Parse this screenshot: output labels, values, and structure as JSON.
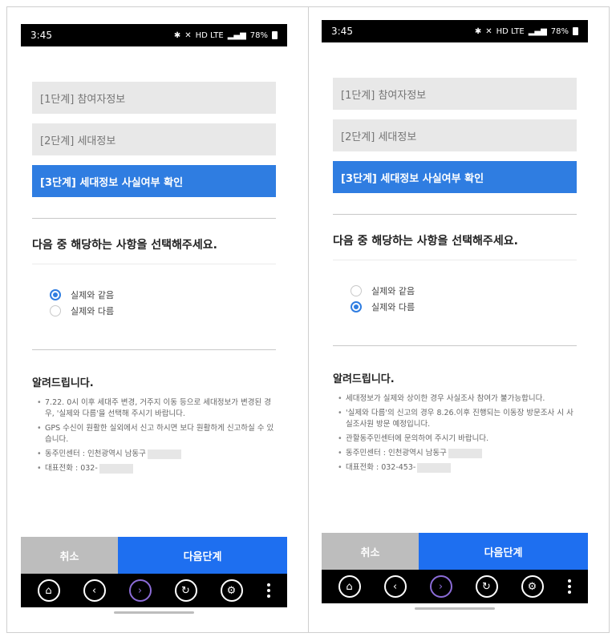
{
  "left": {
    "status": {
      "time": "3:45",
      "signal_text": "HD LTE",
      "battery": "78%"
    },
    "steps": [
      {
        "label": "[1단계] 참여자정보"
      },
      {
        "label": "[2단계] 세대정보"
      },
      {
        "label": "[3단계] 세대정보 사실여부 확인"
      }
    ],
    "question": "다음 중 해당하는 사항을 선택해주세요.",
    "options": [
      {
        "label": "실제와 같음",
        "selected": true
      },
      {
        "label": "실제와 다름",
        "selected": false
      }
    ],
    "notice_title": "알려드립니다.",
    "notices": [
      "7.22. 0시 이후 세대주 변경, 거주지 이동 등으로 세대정보가 변경된 경우, '실제와 다름'을 선택해 주시기 바랍니다.",
      "GPS 수신이 원활한 실외에서 신고 하시면 보다 원활하게 신고하실 수 있습니다.",
      "동주민센터 : 인천광역시 남동구",
      "대표전화 : 032-"
    ],
    "buttons": {
      "cancel": "취소",
      "next": "다음단계"
    }
  },
  "right": {
    "status": {
      "time": "3:45",
      "signal_text": "HD LTE",
      "battery": "78%"
    },
    "steps": [
      {
        "label": "[1단계] 참여자정보"
      },
      {
        "label": "[2단계] 세대정보"
      },
      {
        "label": "[3단계] 세대정보 사실여부 확인"
      }
    ],
    "question": "다음 중 해당하는 사항을 선택해주세요.",
    "options": [
      {
        "label": "실제와 같음",
        "selected": false
      },
      {
        "label": "실제와 다름",
        "selected": true
      }
    ],
    "notice_title": "알려드립니다.",
    "notices": [
      "세대정보가 실제와 상이한 경우 사실조사 참여가 불가능합니다.",
      "'실제와 다름'의 신고의 경우 8.26.이후 진행되는 이동장 방문조사 시 사실조사원 방문 예정입니다.",
      "관할동주민센터에 문의하여 주시기 바랍니다.",
      "동주민센터 : 인천광역시 남동구",
      "대표전화 : 032-453-"
    ],
    "buttons": {
      "cancel": "취소",
      "next": "다음단계"
    }
  },
  "navbar_icons": [
    "home-icon",
    "back-icon",
    "forward-icon",
    "refresh-icon",
    "settings-icon",
    "more-icon"
  ],
  "colors": {
    "accent": "#2f7de1",
    "next_button": "#1e6ff0",
    "cancel_button": "#bdbdbd",
    "forward_icon": "#8c6cd8"
  }
}
